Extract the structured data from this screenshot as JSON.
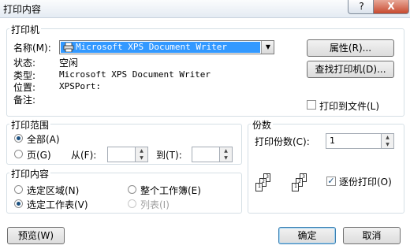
{
  "window": {
    "title": "打印内容",
    "help_label": "?",
    "close_label": "X"
  },
  "printer": {
    "group_label": "打印机",
    "name_label": "名称(M):",
    "name_value": "Microsoft XPS Document Writer",
    "status_label": "状态:",
    "status_value": "空闲",
    "type_label": "类型:",
    "type_value": "Microsoft XPS Document Writer",
    "where_label": "位置:",
    "where_value": "XPSPort:",
    "comment_label": "备注:",
    "properties_button": "属性(R)...",
    "find_button": "查找打印机(D)...",
    "print_to_file_label": "打印到文件(L)",
    "print_to_file_checked": false
  },
  "range": {
    "group_label": "打印范围",
    "all_label": "全部(A)",
    "all_selected": true,
    "pages_label": "页(G)",
    "from_label": "从(F):",
    "from_value": "",
    "to_label": "到(T):",
    "to_value": ""
  },
  "what": {
    "group_label": "打印内容",
    "selection_label": "选定区域(N)",
    "active_sheets_label": "选定工作表(V)",
    "entire_workbook_label": "整个工作簿(E)",
    "list_label": "列表(I)",
    "selected_option": "active_sheets"
  },
  "copies": {
    "group_label": "份数",
    "number_label": "打印份数(C):",
    "number_value": "1",
    "collate_label": "逐份打印(O)",
    "collate_checked": true
  },
  "footer": {
    "preview_button": "预览(W)",
    "ok_button": "确定",
    "cancel_button": "取消"
  }
}
